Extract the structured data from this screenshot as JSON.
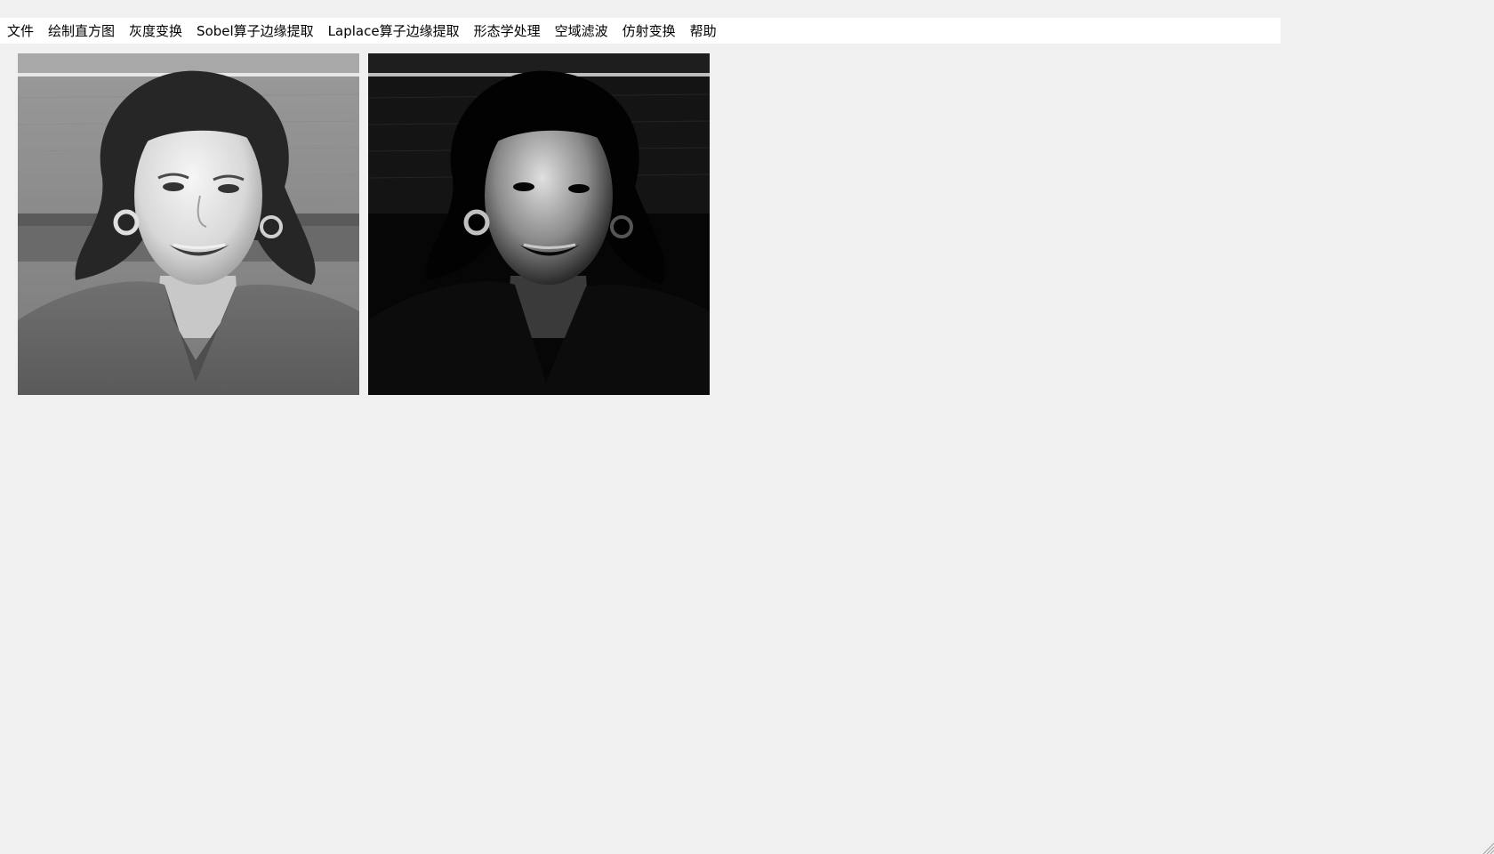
{
  "menubar": {
    "items": [
      {
        "label": "文件"
      },
      {
        "label": "绘制直方图"
      },
      {
        "label": "灰度变换"
      },
      {
        "label": "Sobel算子边缘提取"
      },
      {
        "label": "Laplace算子边缘提取"
      },
      {
        "label": "形态学处理"
      },
      {
        "label": "空域滤波"
      },
      {
        "label": "仿射变换"
      },
      {
        "label": "帮助"
      }
    ]
  },
  "images": {
    "original": {
      "content": "grayscale portrait photo of smiling woman with curly hair, earrings, in front of wood paneling",
      "tone": "normal"
    },
    "processed": {
      "content": "same portrait after gray-level transformation",
      "tone": "darkened"
    }
  },
  "colors": {
    "window_bg": "#f0f0f0",
    "menubar_bg": "#ffffff",
    "menu_text": "#000000"
  }
}
